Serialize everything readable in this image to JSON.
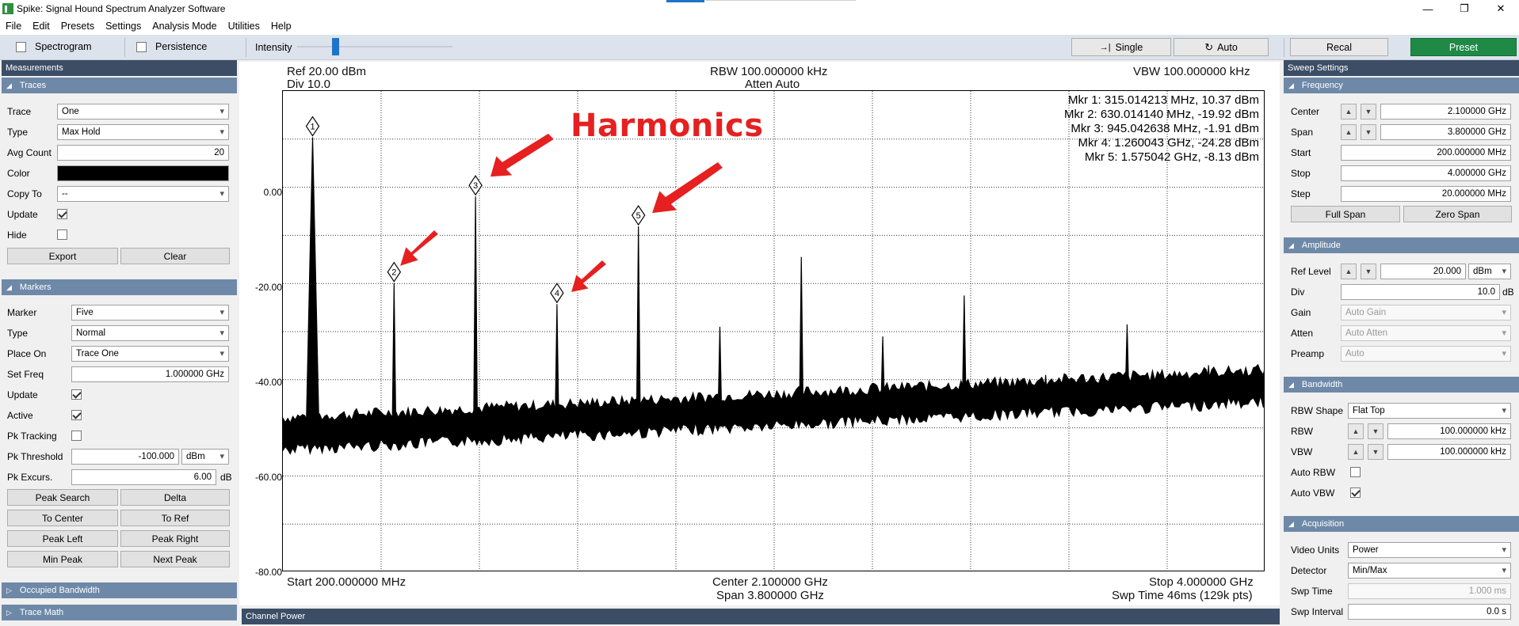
{
  "window": {
    "title": "Spike: Signal Hound Spectrum Analyzer Software",
    "minimize": "—",
    "restore": "❐",
    "close": "✕"
  },
  "menu": [
    "File",
    "Edit",
    "Presets",
    "Settings",
    "Analysis Mode",
    "Utilities",
    "Help"
  ],
  "toolbar": {
    "spectrogram": "Spectrogram",
    "persistence": "Persistence",
    "intensity": "Intensity",
    "single": "Single",
    "auto": "Auto",
    "recal": "Recal",
    "preset": "Preset",
    "single_icon": "→|",
    "auto_icon": "↻"
  },
  "left": {
    "measurements": "Measurements",
    "traces": {
      "title": "Traces",
      "trace_label": "Trace",
      "trace_val": "One",
      "type_label": "Type",
      "type_val": "Max Hold",
      "avg_label": "Avg Count",
      "avg_val": "20",
      "color_label": "Color",
      "copy_label": "Copy To",
      "copy_val": "--",
      "update_label": "Update",
      "hide_label": "Hide",
      "export": "Export",
      "clear": "Clear"
    },
    "markers": {
      "title": "Markers",
      "marker_label": "Marker",
      "marker_val": "Five",
      "type_label": "Type",
      "type_val": "Normal",
      "place_label": "Place On",
      "place_val": "Trace One",
      "setfreq_label": "Set Freq",
      "setfreq_val": "1.000000 GHz",
      "update_label": "Update",
      "active_label": "Active",
      "pktrack_label": "Pk Tracking",
      "pkthresh_label": "Pk Threshold",
      "pkthresh_val": "-100.000",
      "pkthresh_unit": "dBm",
      "pkexc_label": "Pk Excurs.",
      "pkexc_val": "6.00",
      "pkexc_unit": "dB",
      "peak_search": "Peak Search",
      "delta": "Delta",
      "to_center": "To Center",
      "to_ref": "To Ref",
      "peak_left": "Peak Left",
      "peak_right": "Peak Right",
      "min_peak": "Min Peak",
      "next_peak": "Next Peak"
    },
    "occupied_bw": "Occupied Bandwidth",
    "trace_math": "Trace Math"
  },
  "plot": {
    "ref": "Ref 20.00 dBm",
    "div": "Div 10.0",
    "rbw": "RBW 100.000000 kHz",
    "atten": "Atten Auto",
    "vbw": "VBW 100.000000 kHz",
    "start": "Start 200.000000 MHz",
    "center": "Center 2.100000 GHz",
    "span": "Span 3.800000 GHz",
    "stop": "Stop 4.000000 GHz",
    "swp": "Swp Time 46ms (129k pts)",
    "y_labels": [
      "0.00",
      "-20.00",
      "-40.00",
      "-60.00",
      "-80.00"
    ],
    "markers_readout": [
      "Mkr 1: 315.014213 MHz, 10.37 dBm",
      "Mkr 2: 630.014140 MHz, -19.92 dBm",
      "Mkr 3: 945.042638 MHz, -1.91 dBm",
      "Mkr 4: 1.260043 GHz, -24.28 dBm",
      "Mkr 5: 1.575042 GHz, -8.13 dBm"
    ],
    "annotation": "Harmonics",
    "channel_power": "Channel Power"
  },
  "chart_data": {
    "type": "line",
    "x_unit": "GHz",
    "y_unit": "dBm",
    "xlim": [
      0.2,
      4.0
    ],
    "ylim": [
      -80,
      20
    ],
    "peaks": [
      {
        "x": 0.315,
        "y": 10.37,
        "marker": "1"
      },
      {
        "x": 0.63,
        "y": -19.92,
        "marker": "2"
      },
      {
        "x": 0.945,
        "y": -1.91,
        "marker": "3"
      },
      {
        "x": 1.26,
        "y": -24.28,
        "marker": "4"
      },
      {
        "x": 1.575,
        "y": -8.13,
        "marker": "5"
      },
      {
        "x": 1.89,
        "y": -29.0
      },
      {
        "x": 2.205,
        "y": -14.5
      },
      {
        "x": 2.52,
        "y": -31.0
      },
      {
        "x": 2.835,
        "y": -22.5
      },
      {
        "x": 3.15,
        "y": -39.0
      },
      {
        "x": 3.465,
        "y": -28.5
      },
      {
        "x": 3.78,
        "y": -37.0
      }
    ],
    "noise_floor": [
      {
        "x": 0.2,
        "y": -51
      },
      {
        "x": 4.0,
        "y": -41
      }
    ],
    "grid": true
  },
  "right": {
    "sweep": "Sweep Settings",
    "frequency": {
      "title": "Frequency",
      "center_label": "Center",
      "center_val": "2.100000 GHz",
      "span_label": "Span",
      "span_val": "3.800000 GHz",
      "start_label": "Start",
      "start_val": "200.000000 MHz",
      "stop_label": "Stop",
      "stop_val": "4.000000 GHz",
      "step_label": "Step",
      "step_val": "20.000000 MHz",
      "full_span": "Full Span",
      "zero_span": "Zero Span"
    },
    "amplitude": {
      "title": "Amplitude",
      "ref_label": "Ref Level",
      "ref_val": "20.000",
      "ref_unit": "dBm",
      "div_label": "Div",
      "div_val": "10.0",
      "div_unit": "dB",
      "gain_label": "Gain",
      "gain_val": "Auto Gain",
      "atten_label": "Atten",
      "atten_val": "Auto Atten",
      "preamp_label": "Preamp",
      "preamp_val": "Auto"
    },
    "bandwidth": {
      "title": "Bandwidth",
      "shape_label": "RBW Shape",
      "shape_val": "Flat Top",
      "rbw_label": "RBW",
      "rbw_val": "100.000000 kHz",
      "vbw_label": "VBW",
      "vbw_val": "100.000000 kHz",
      "autorbw_label": "Auto RBW",
      "autovbw_label": "Auto VBW"
    },
    "acquisition": {
      "title": "Acquisition",
      "video_label": "Video Units",
      "video_val": "Power",
      "detector_label": "Detector",
      "detector_val": "Min/Max",
      "swptime_label": "Swp Time",
      "swptime_val": "1.000 ms",
      "swpint_label": "Swp Interval",
      "swpint_val": "0.0 s"
    }
  },
  "colors": {
    "accent": "#1e74c8",
    "header_dark": "#3c4e66",
    "header_section": "#6e89a8",
    "preset_green": "#1e8a46",
    "annotation_red": "#e62020"
  }
}
